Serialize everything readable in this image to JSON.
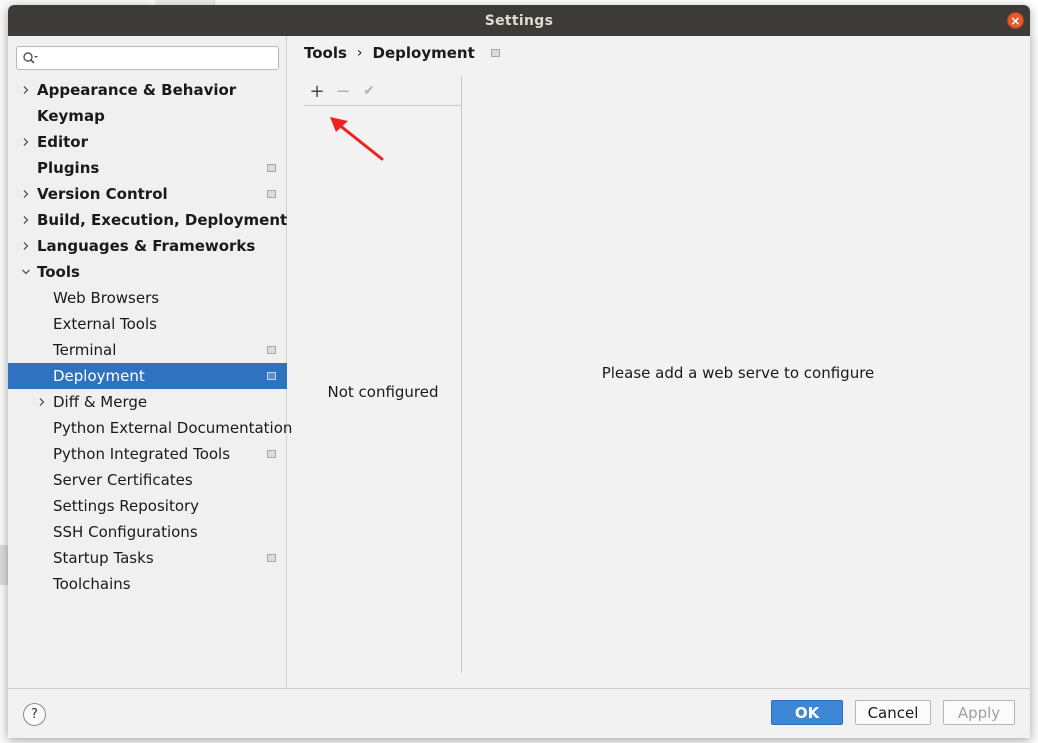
{
  "window": {
    "title": "Settings"
  },
  "search": {
    "placeholder": ""
  },
  "sidebar": {
    "items": [
      {
        "label": "Appearance & Behavior",
        "level": 0,
        "chevron": "right",
        "project_icon": false,
        "selected": false
      },
      {
        "label": "Keymap",
        "level": 0,
        "chevron": "none",
        "project_icon": false,
        "selected": false
      },
      {
        "label": "Editor",
        "level": 0,
        "chevron": "right",
        "project_icon": false,
        "selected": false
      },
      {
        "label": "Plugins",
        "level": 0,
        "chevron": "none",
        "project_icon": true,
        "selected": false
      },
      {
        "label": "Version Control",
        "level": 0,
        "chevron": "right",
        "project_icon": true,
        "selected": false
      },
      {
        "label": "Build, Execution, Deployment",
        "level": 0,
        "chevron": "right",
        "project_icon": false,
        "selected": false
      },
      {
        "label": "Languages & Frameworks",
        "level": 0,
        "chevron": "right",
        "project_icon": false,
        "selected": false
      },
      {
        "label": "Tools",
        "level": 0,
        "chevron": "down",
        "project_icon": false,
        "selected": false
      },
      {
        "label": "Web Browsers",
        "level": 1,
        "chevron": "none",
        "project_icon": false,
        "selected": false
      },
      {
        "label": "External Tools",
        "level": 1,
        "chevron": "none",
        "project_icon": false,
        "selected": false
      },
      {
        "label": "Terminal",
        "level": 1,
        "chevron": "none",
        "project_icon": true,
        "selected": false
      },
      {
        "label": "Deployment",
        "level": 1,
        "chevron": "none",
        "project_icon": true,
        "selected": true
      },
      {
        "label": "Diff & Merge",
        "level": 1,
        "chevron": "right",
        "project_icon": false,
        "selected": false
      },
      {
        "label": "Python External Documentation",
        "level": 1,
        "chevron": "none",
        "project_icon": false,
        "selected": false
      },
      {
        "label": "Python Integrated Tools",
        "level": 1,
        "chevron": "none",
        "project_icon": true,
        "selected": false
      },
      {
        "label": "Server Certificates",
        "level": 1,
        "chevron": "none",
        "project_icon": false,
        "selected": false
      },
      {
        "label": "Settings Repository",
        "level": 1,
        "chevron": "none",
        "project_icon": false,
        "selected": false
      },
      {
        "label": "SSH Configurations",
        "level": 1,
        "chevron": "none",
        "project_icon": false,
        "selected": false
      },
      {
        "label": "Startup Tasks",
        "level": 1,
        "chevron": "none",
        "project_icon": true,
        "selected": false
      },
      {
        "label": "Toolchains",
        "level": 1,
        "chevron": "none",
        "project_icon": false,
        "selected": false
      }
    ]
  },
  "breadcrumb": {
    "parent": "Tools",
    "separator": "›",
    "current": "Deployment"
  },
  "toolbar": {
    "add_label": "+",
    "remove_label": "−",
    "apply_label": "✔"
  },
  "list": {
    "empty_text": "Not configured"
  },
  "detail": {
    "message": "Please add a web serve to configure"
  },
  "footer": {
    "help_label": "?",
    "ok_label": "OK",
    "cancel_label": "Cancel",
    "apply_label": "Apply"
  },
  "colors": {
    "selection": "#2f73c0",
    "ok_button": "#3e86d6",
    "titlebar": "#3c3b37",
    "close_button": "#e9582d",
    "annotation_arrow": "#ee2222"
  }
}
